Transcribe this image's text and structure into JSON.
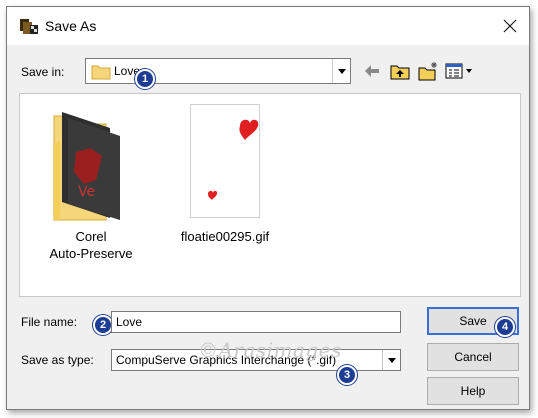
{
  "window": {
    "title": "Save As"
  },
  "save_in": {
    "label": "Save in:",
    "value": "Love"
  },
  "toolbar": [
    "back-arrow-icon",
    "up-folder-icon",
    "new-folder-icon",
    "view-menu-icon"
  ],
  "files": [
    {
      "name": "Corel Auto-Preserve",
      "line1": "Corel",
      "line2": "Auto-Preserve",
      "type": "folder"
    },
    {
      "name": "floatie00295.gif",
      "type": "gif"
    }
  ],
  "file_name": {
    "label": "File name:",
    "value": "Love"
  },
  "save_as_type": {
    "label": "Save as type:",
    "value": "CompuServe Graphics Interchange (*.gif)"
  },
  "buttons": {
    "save": "Save",
    "cancel": "Cancel",
    "help": "Help"
  },
  "badges": [
    "1",
    "2",
    "3",
    "4"
  ],
  "watermark": "©Arasimages",
  "colors": {
    "badge": "#1c3d93",
    "default_button_border": "#3a6fd8",
    "dialog_bg": "#f0f0f0"
  }
}
